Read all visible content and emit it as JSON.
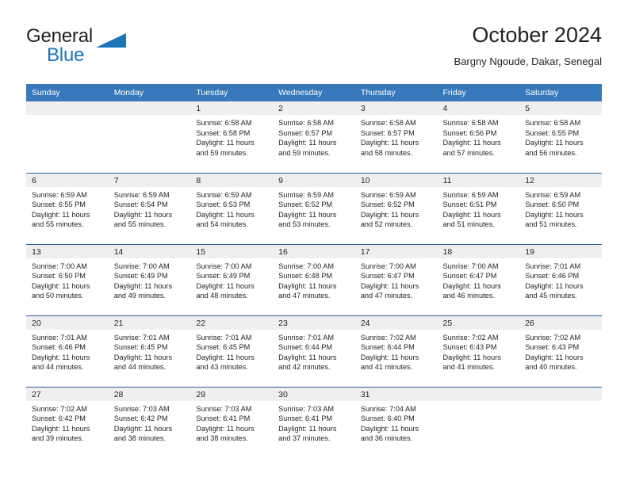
{
  "brand": {
    "name_top": "General",
    "name_bottom": "Blue",
    "accent_color": "#1b75bb"
  },
  "header": {
    "title": "October 2024",
    "subtitle": "Bargny Ngoude, Dakar, Senegal"
  },
  "theme": {
    "header_bar_color": "#3879bb",
    "row_divider_color": "#2a6099",
    "daynum_band_color": "#efefef",
    "text_color": "#231f20"
  },
  "labels": {
    "sunrise_prefix": "Sunrise:",
    "sunset_prefix": "Sunset:",
    "daylight_prefix": "Daylight:"
  },
  "weekday_headers": [
    "Sunday",
    "Monday",
    "Tuesday",
    "Wednesday",
    "Thursday",
    "Friday",
    "Saturday"
  ],
  "weeks": [
    [
      {
        "day": "",
        "empty": true
      },
      {
        "day": "",
        "empty": true
      },
      {
        "day": "1",
        "sunrise": "Sunrise: 6:58 AM",
        "sunset": "Sunset: 6:58 PM",
        "daylight_line1": "Daylight: 11 hours",
        "daylight_line2": "and 59 minutes."
      },
      {
        "day": "2",
        "sunrise": "Sunrise: 6:58 AM",
        "sunset": "Sunset: 6:57 PM",
        "daylight_line1": "Daylight: 11 hours",
        "daylight_line2": "and 59 minutes."
      },
      {
        "day": "3",
        "sunrise": "Sunrise: 6:58 AM",
        "sunset": "Sunset: 6:57 PM",
        "daylight_line1": "Daylight: 11 hours",
        "daylight_line2": "and 58 minutes."
      },
      {
        "day": "4",
        "sunrise": "Sunrise: 6:58 AM",
        "sunset": "Sunset: 6:56 PM",
        "daylight_line1": "Daylight: 11 hours",
        "daylight_line2": "and 57 minutes."
      },
      {
        "day": "5",
        "sunrise": "Sunrise: 6:58 AM",
        "sunset": "Sunset: 6:55 PM",
        "daylight_line1": "Daylight: 11 hours",
        "daylight_line2": "and 56 minutes."
      }
    ],
    [
      {
        "day": "6",
        "sunrise": "Sunrise: 6:59 AM",
        "sunset": "Sunset: 6:55 PM",
        "daylight_line1": "Daylight: 11 hours",
        "daylight_line2": "and 55 minutes."
      },
      {
        "day": "7",
        "sunrise": "Sunrise: 6:59 AM",
        "sunset": "Sunset: 6:54 PM",
        "daylight_line1": "Daylight: 11 hours",
        "daylight_line2": "and 55 minutes."
      },
      {
        "day": "8",
        "sunrise": "Sunrise: 6:59 AM",
        "sunset": "Sunset: 6:53 PM",
        "daylight_line1": "Daylight: 11 hours",
        "daylight_line2": "and 54 minutes."
      },
      {
        "day": "9",
        "sunrise": "Sunrise: 6:59 AM",
        "sunset": "Sunset: 6:52 PM",
        "daylight_line1": "Daylight: 11 hours",
        "daylight_line2": "and 53 minutes."
      },
      {
        "day": "10",
        "sunrise": "Sunrise: 6:59 AM",
        "sunset": "Sunset: 6:52 PM",
        "daylight_line1": "Daylight: 11 hours",
        "daylight_line2": "and 52 minutes."
      },
      {
        "day": "11",
        "sunrise": "Sunrise: 6:59 AM",
        "sunset": "Sunset: 6:51 PM",
        "daylight_line1": "Daylight: 11 hours",
        "daylight_line2": "and 51 minutes."
      },
      {
        "day": "12",
        "sunrise": "Sunrise: 6:59 AM",
        "sunset": "Sunset: 6:50 PM",
        "daylight_line1": "Daylight: 11 hours",
        "daylight_line2": "and 51 minutes."
      }
    ],
    [
      {
        "day": "13",
        "sunrise": "Sunrise: 7:00 AM",
        "sunset": "Sunset: 6:50 PM",
        "daylight_line1": "Daylight: 11 hours",
        "daylight_line2": "and 50 minutes."
      },
      {
        "day": "14",
        "sunrise": "Sunrise: 7:00 AM",
        "sunset": "Sunset: 6:49 PM",
        "daylight_line1": "Daylight: 11 hours",
        "daylight_line2": "and 49 minutes."
      },
      {
        "day": "15",
        "sunrise": "Sunrise: 7:00 AM",
        "sunset": "Sunset: 6:49 PM",
        "daylight_line1": "Daylight: 11 hours",
        "daylight_line2": "and 48 minutes."
      },
      {
        "day": "16",
        "sunrise": "Sunrise: 7:00 AM",
        "sunset": "Sunset: 6:48 PM",
        "daylight_line1": "Daylight: 11 hours",
        "daylight_line2": "and 47 minutes."
      },
      {
        "day": "17",
        "sunrise": "Sunrise: 7:00 AM",
        "sunset": "Sunset: 6:47 PM",
        "daylight_line1": "Daylight: 11 hours",
        "daylight_line2": "and 47 minutes."
      },
      {
        "day": "18",
        "sunrise": "Sunrise: 7:00 AM",
        "sunset": "Sunset: 6:47 PM",
        "daylight_line1": "Daylight: 11 hours",
        "daylight_line2": "and 46 minutes."
      },
      {
        "day": "19",
        "sunrise": "Sunrise: 7:01 AM",
        "sunset": "Sunset: 6:46 PM",
        "daylight_line1": "Daylight: 11 hours",
        "daylight_line2": "and 45 minutes."
      }
    ],
    [
      {
        "day": "20",
        "sunrise": "Sunrise: 7:01 AM",
        "sunset": "Sunset: 6:46 PM",
        "daylight_line1": "Daylight: 11 hours",
        "daylight_line2": "and 44 minutes."
      },
      {
        "day": "21",
        "sunrise": "Sunrise: 7:01 AM",
        "sunset": "Sunset: 6:45 PM",
        "daylight_line1": "Daylight: 11 hours",
        "daylight_line2": "and 44 minutes."
      },
      {
        "day": "22",
        "sunrise": "Sunrise: 7:01 AM",
        "sunset": "Sunset: 6:45 PM",
        "daylight_line1": "Daylight: 11 hours",
        "daylight_line2": "and 43 minutes."
      },
      {
        "day": "23",
        "sunrise": "Sunrise: 7:01 AM",
        "sunset": "Sunset: 6:44 PM",
        "daylight_line1": "Daylight: 11 hours",
        "daylight_line2": "and 42 minutes."
      },
      {
        "day": "24",
        "sunrise": "Sunrise: 7:02 AM",
        "sunset": "Sunset: 6:44 PM",
        "daylight_line1": "Daylight: 11 hours",
        "daylight_line2": "and 41 minutes."
      },
      {
        "day": "25",
        "sunrise": "Sunrise: 7:02 AM",
        "sunset": "Sunset: 6:43 PM",
        "daylight_line1": "Daylight: 11 hours",
        "daylight_line2": "and 41 minutes."
      },
      {
        "day": "26",
        "sunrise": "Sunrise: 7:02 AM",
        "sunset": "Sunset: 6:43 PM",
        "daylight_line1": "Daylight: 11 hours",
        "daylight_line2": "and 40 minutes."
      }
    ],
    [
      {
        "day": "27",
        "sunrise": "Sunrise: 7:02 AM",
        "sunset": "Sunset: 6:42 PM",
        "daylight_line1": "Daylight: 11 hours",
        "daylight_line2": "and 39 minutes."
      },
      {
        "day": "28",
        "sunrise": "Sunrise: 7:03 AM",
        "sunset": "Sunset: 6:42 PM",
        "daylight_line1": "Daylight: 11 hours",
        "daylight_line2": "and 38 minutes."
      },
      {
        "day": "29",
        "sunrise": "Sunrise: 7:03 AM",
        "sunset": "Sunset: 6:41 PM",
        "daylight_line1": "Daylight: 11 hours",
        "daylight_line2": "and 38 minutes."
      },
      {
        "day": "30",
        "sunrise": "Sunrise: 7:03 AM",
        "sunset": "Sunset: 6:41 PM",
        "daylight_line1": "Daylight: 11 hours",
        "daylight_line2": "and 37 minutes."
      },
      {
        "day": "31",
        "sunrise": "Sunrise: 7:04 AM",
        "sunset": "Sunset: 6:40 PM",
        "daylight_line1": "Daylight: 11 hours",
        "daylight_line2": "and 36 minutes."
      },
      {
        "day": "",
        "empty": true
      },
      {
        "day": "",
        "empty": true
      }
    ]
  ]
}
